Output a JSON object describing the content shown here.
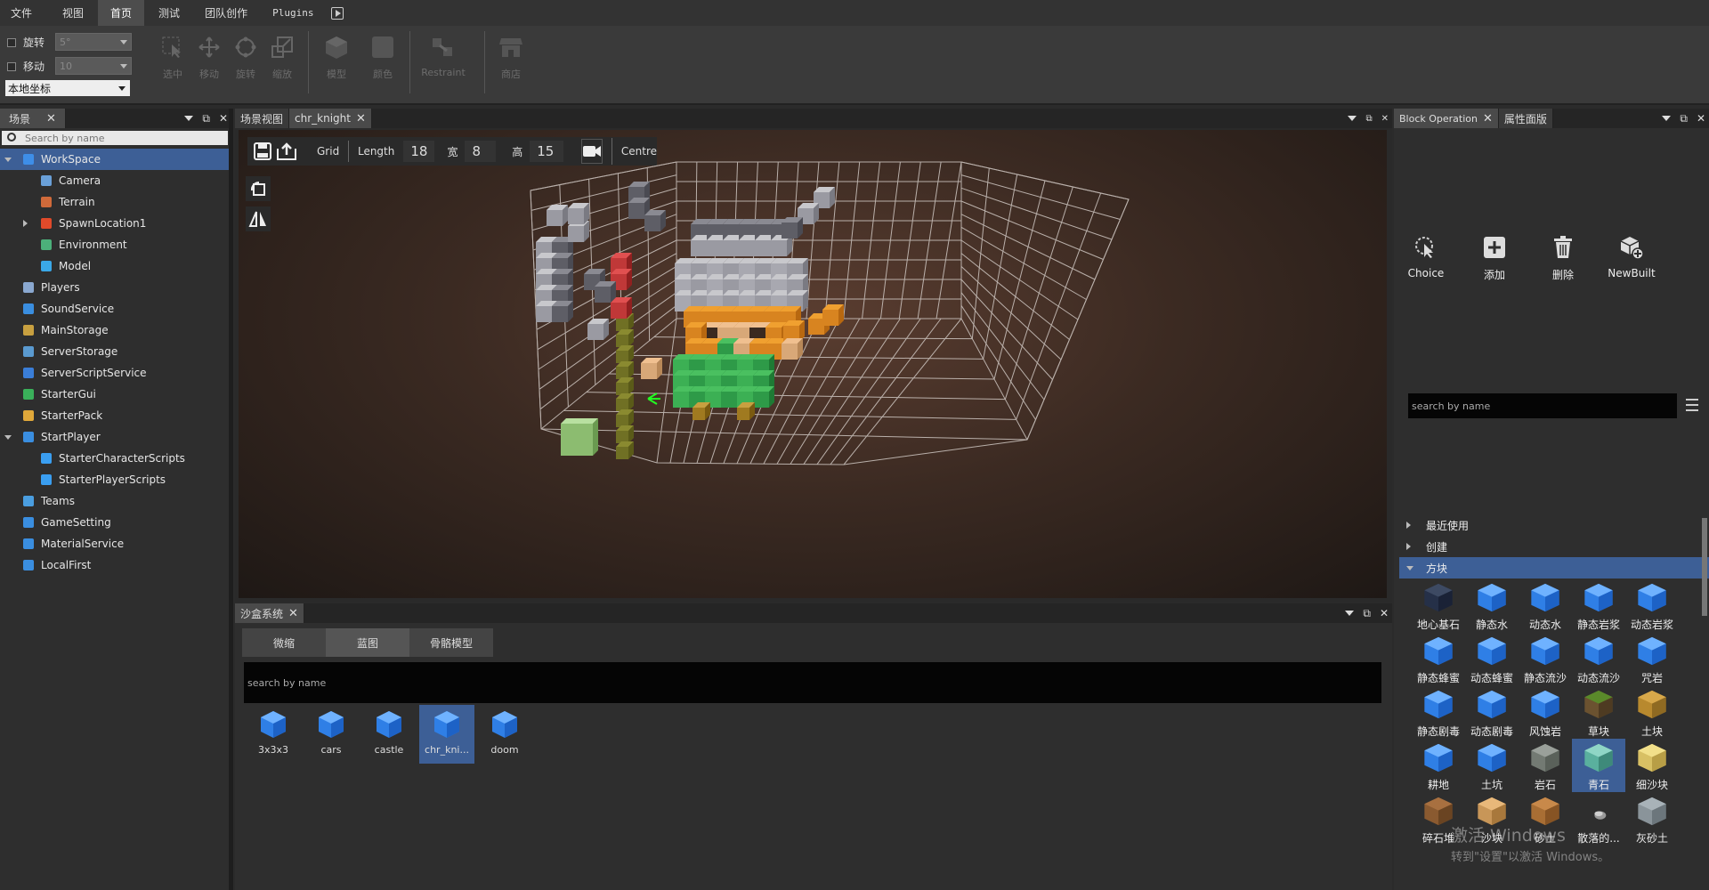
{
  "menu": {
    "items": [
      "文件",
      "视图",
      "首页",
      "测试",
      "团队创作",
      "Plugins"
    ],
    "active_index": 2
  },
  "toolbar": {
    "rotate_label": "旋转",
    "rotate_value": "5°",
    "move_label": "移动",
    "move_value": "10",
    "coord_value": "本地坐标",
    "tools": [
      "选中",
      "移动",
      "旋转",
      "缩放"
    ],
    "model_label": "模型",
    "color_label": "颜色",
    "restraint_label": "Restraint",
    "shop_label": "商店"
  },
  "scene_panel": {
    "tab": "场景",
    "search_placeholder": "Search by name",
    "items": [
      {
        "label": "WorkSpace",
        "indent": 0,
        "expanded": true,
        "selected": true,
        "color": "#3e8ee8"
      },
      {
        "label": "Camera",
        "indent": 1,
        "color": "#6aa0d8"
      },
      {
        "label": "Terrain",
        "indent": 1,
        "color": "#d06a3a"
      },
      {
        "label": "SpawnLocation1",
        "indent": 1,
        "collapsed": true,
        "color": "#e04a2a"
      },
      {
        "label": "Environment",
        "indent": 1,
        "color": "#4cb07a"
      },
      {
        "label": "Model",
        "indent": 1,
        "color": "#3aa8e8"
      },
      {
        "label": "Players",
        "indent": 0,
        "color": "#8aa8d0"
      },
      {
        "label": "SoundService",
        "indent": 0,
        "color": "#3a8ee0"
      },
      {
        "label": "MainStorage",
        "indent": 0,
        "color": "#c8a040"
      },
      {
        "label": "ServerStorage",
        "indent": 0,
        "color": "#5a9ad0"
      },
      {
        "label": "ServerScriptService",
        "indent": 0,
        "color": "#3a7ed8"
      },
      {
        "label": "StarterGui",
        "indent": 0,
        "color": "#3ab05a"
      },
      {
        "label": "StarterPack",
        "indent": 0,
        "color": "#e0a83a"
      },
      {
        "label": "StartPlayer",
        "indent": 0,
        "expanded": true,
        "color": "#3a8ee0"
      },
      {
        "label": "StarterCharacterScripts",
        "indent": 1,
        "color": "#3a9ef0"
      },
      {
        "label": "StarterPlayerScripts",
        "indent": 1,
        "color": "#3a9ef0"
      },
      {
        "label": "Teams",
        "indent": 0,
        "color": "#4a9ee0"
      },
      {
        "label": "GameSetting",
        "indent": 0,
        "color": "#3a8ee0"
      },
      {
        "label": "MaterialService",
        "indent": 0,
        "color": "#3a8ee0"
      },
      {
        "label": "LocalFirst",
        "indent": 0,
        "color": "#3a8ee0"
      }
    ]
  },
  "viewport": {
    "tabs": [
      "场景视图",
      "chr_knight"
    ],
    "grid_label": "Grid",
    "length_label": "Length",
    "length_value": "18",
    "width_label": "宽",
    "width_value": "8",
    "height_label": "高",
    "height_value": "15",
    "centre_label": "Centre"
  },
  "sandbox": {
    "tab": "沙盒系统",
    "tabs": [
      "微缩",
      "蓝图",
      "骨骼模型"
    ],
    "selected_tab": 1,
    "search_placeholder": "search by name",
    "assets": [
      "3x3x3",
      "cars",
      "castle",
      "chr_kni...",
      "doom"
    ],
    "selected_asset": 3
  },
  "right_panel": {
    "tabs": [
      "Block Operation",
      "属性面版"
    ],
    "ops": [
      "Choice",
      "添加",
      "删除",
      "NewBuilt"
    ],
    "search_placeholder": "search by name",
    "categories": [
      {
        "label": "最近使用"
      },
      {
        "label": "创建"
      },
      {
        "label": "方块",
        "expanded": true
      }
    ],
    "blocks": [
      {
        "label": "地心基石",
        "kind": "dark"
      },
      {
        "label": "静态水",
        "kind": "blue"
      },
      {
        "label": "动态水",
        "kind": "blue"
      },
      {
        "label": "静态岩浆",
        "kind": "blue"
      },
      {
        "label": "动态岩浆",
        "kind": "blue"
      },
      {
        "label": "静态蜂蜜",
        "kind": "blue"
      },
      {
        "label": "动态蜂蜜",
        "kind": "blue"
      },
      {
        "label": "静态流沙",
        "kind": "blue"
      },
      {
        "label": "动态流沙",
        "kind": "blue"
      },
      {
        "label": "咒岩",
        "kind": "blue"
      },
      {
        "label": "静态剧毒",
        "kind": "blue"
      },
      {
        "label": "动态剧毒",
        "kind": "blue"
      },
      {
        "label": "风蚀岩",
        "kind": "blue"
      },
      {
        "label": "草块",
        "kind": "grass"
      },
      {
        "label": "土块",
        "kind": "dirt"
      },
      {
        "label": "耕地",
        "kind": "blue"
      },
      {
        "label": "土坑",
        "kind": "blue"
      },
      {
        "label": "岩石",
        "kind": "stone"
      },
      {
        "label": "青石",
        "kind": "cyan"
      },
      {
        "label": "细沙块",
        "kind": "sand"
      },
      {
        "label": "碎石堆",
        "kind": "brown"
      },
      {
        "label": "沙块",
        "kind": "tan"
      },
      {
        "label": "砂土",
        "kind": "brown2"
      },
      {
        "label": "散落的...",
        "kind": "pebble"
      },
      {
        "label": "灰砂土",
        "kind": "grey"
      }
    ],
    "selected_block": 18
  },
  "watermark": {
    "line1": "激活 Windows",
    "line2": "转到\"设置\"以激活 Windows。"
  },
  "colors": {
    "selection": "#3d5f96",
    "accent_blue": "#3e8ee8"
  }
}
